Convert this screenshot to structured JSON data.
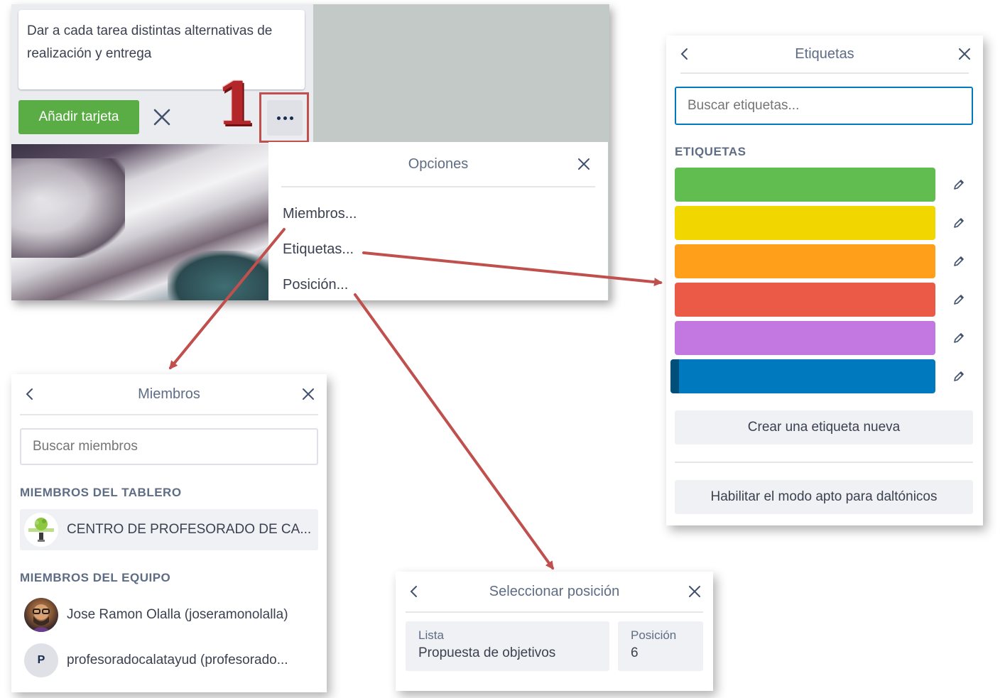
{
  "board": {
    "composer_text": "Dar a cada tarea distintas alternativas de realización y entrega",
    "add_card_label": "Añadir tarjeta",
    "step_number": "1"
  },
  "opciones": {
    "title": "Opciones",
    "items": [
      {
        "label": "Miembros..."
      },
      {
        "label": "Etiquetas..."
      },
      {
        "label": "Posición..."
      }
    ]
  },
  "etiquetas": {
    "title": "Etiquetas",
    "search_placeholder": "Buscar etiquetas...",
    "section_label": "ETIQUETAS",
    "labels": [
      {
        "color": "#61bd4f",
        "selected": false
      },
      {
        "color": "#f2d600",
        "selected": false
      },
      {
        "color": "#ff9f1a",
        "selected": false
      },
      {
        "color": "#eb5a46",
        "selected": false
      },
      {
        "color": "#c377e0",
        "selected": false
      },
      {
        "color": "#0079bf",
        "selected": true
      }
    ],
    "create_label": "Crear una etiqueta nueva",
    "colorblind_label": "Habilitar el modo apto para daltónicos"
  },
  "miembros": {
    "title": "Miembros",
    "search_placeholder": "Buscar miembros",
    "board_section": "MIEMBROS DEL TABLERO",
    "board_members": [
      {
        "name": "CENTRO DE PROFESORADO DE CA...",
        "avatar": "logo-icon"
      }
    ],
    "team_section": "MIEMBROS DEL EQUIPO",
    "team_members": [
      {
        "name": "Jose Ramon Olalla (joseramonolalla)",
        "avatar": "photo"
      },
      {
        "name": "profesoradocalatayud (profesorado...",
        "avatar": "initial",
        "initial": "P"
      }
    ]
  },
  "posicion": {
    "title": "Seleccionar posición",
    "list_label": "Lista",
    "list_value": "Propuesta de objetivos",
    "position_label": "Posición",
    "position_value": "6"
  },
  "colors": {
    "accent_green": "#5aac44",
    "highlight_red": "#c0504d",
    "arrow_red": "#c0504d"
  }
}
